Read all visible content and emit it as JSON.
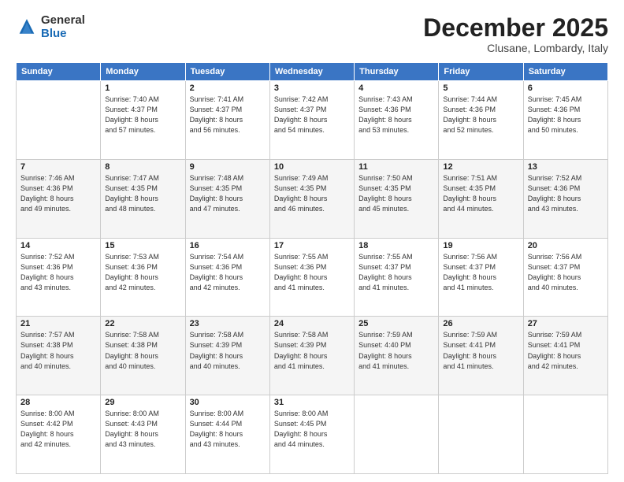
{
  "header": {
    "logo_general": "General",
    "logo_blue": "Blue",
    "month_title": "December 2025",
    "location": "Clusane, Lombardy, Italy"
  },
  "days_of_week": [
    "Sunday",
    "Monday",
    "Tuesday",
    "Wednesday",
    "Thursday",
    "Friday",
    "Saturday"
  ],
  "weeks": [
    [
      {
        "day": "",
        "info": ""
      },
      {
        "day": "1",
        "info": "Sunrise: 7:40 AM\nSunset: 4:37 PM\nDaylight: 8 hours\nand 57 minutes."
      },
      {
        "day": "2",
        "info": "Sunrise: 7:41 AM\nSunset: 4:37 PM\nDaylight: 8 hours\nand 56 minutes."
      },
      {
        "day": "3",
        "info": "Sunrise: 7:42 AM\nSunset: 4:37 PM\nDaylight: 8 hours\nand 54 minutes."
      },
      {
        "day": "4",
        "info": "Sunrise: 7:43 AM\nSunset: 4:36 PM\nDaylight: 8 hours\nand 53 minutes."
      },
      {
        "day": "5",
        "info": "Sunrise: 7:44 AM\nSunset: 4:36 PM\nDaylight: 8 hours\nand 52 minutes."
      },
      {
        "day": "6",
        "info": "Sunrise: 7:45 AM\nSunset: 4:36 PM\nDaylight: 8 hours\nand 50 minutes."
      }
    ],
    [
      {
        "day": "7",
        "info": "Sunrise: 7:46 AM\nSunset: 4:36 PM\nDaylight: 8 hours\nand 49 minutes."
      },
      {
        "day": "8",
        "info": "Sunrise: 7:47 AM\nSunset: 4:35 PM\nDaylight: 8 hours\nand 48 minutes."
      },
      {
        "day": "9",
        "info": "Sunrise: 7:48 AM\nSunset: 4:35 PM\nDaylight: 8 hours\nand 47 minutes."
      },
      {
        "day": "10",
        "info": "Sunrise: 7:49 AM\nSunset: 4:35 PM\nDaylight: 8 hours\nand 46 minutes."
      },
      {
        "day": "11",
        "info": "Sunrise: 7:50 AM\nSunset: 4:35 PM\nDaylight: 8 hours\nand 45 minutes."
      },
      {
        "day": "12",
        "info": "Sunrise: 7:51 AM\nSunset: 4:35 PM\nDaylight: 8 hours\nand 44 minutes."
      },
      {
        "day": "13",
        "info": "Sunrise: 7:52 AM\nSunset: 4:36 PM\nDaylight: 8 hours\nand 43 minutes."
      }
    ],
    [
      {
        "day": "14",
        "info": "Sunrise: 7:52 AM\nSunset: 4:36 PM\nDaylight: 8 hours\nand 43 minutes."
      },
      {
        "day": "15",
        "info": "Sunrise: 7:53 AM\nSunset: 4:36 PM\nDaylight: 8 hours\nand 42 minutes."
      },
      {
        "day": "16",
        "info": "Sunrise: 7:54 AM\nSunset: 4:36 PM\nDaylight: 8 hours\nand 42 minutes."
      },
      {
        "day": "17",
        "info": "Sunrise: 7:55 AM\nSunset: 4:36 PM\nDaylight: 8 hours\nand 41 minutes."
      },
      {
        "day": "18",
        "info": "Sunrise: 7:55 AM\nSunset: 4:37 PM\nDaylight: 8 hours\nand 41 minutes."
      },
      {
        "day": "19",
        "info": "Sunrise: 7:56 AM\nSunset: 4:37 PM\nDaylight: 8 hours\nand 41 minutes."
      },
      {
        "day": "20",
        "info": "Sunrise: 7:56 AM\nSunset: 4:37 PM\nDaylight: 8 hours\nand 40 minutes."
      }
    ],
    [
      {
        "day": "21",
        "info": "Sunrise: 7:57 AM\nSunset: 4:38 PM\nDaylight: 8 hours\nand 40 minutes."
      },
      {
        "day": "22",
        "info": "Sunrise: 7:58 AM\nSunset: 4:38 PM\nDaylight: 8 hours\nand 40 minutes."
      },
      {
        "day": "23",
        "info": "Sunrise: 7:58 AM\nSunset: 4:39 PM\nDaylight: 8 hours\nand 40 minutes."
      },
      {
        "day": "24",
        "info": "Sunrise: 7:58 AM\nSunset: 4:39 PM\nDaylight: 8 hours\nand 41 minutes."
      },
      {
        "day": "25",
        "info": "Sunrise: 7:59 AM\nSunset: 4:40 PM\nDaylight: 8 hours\nand 41 minutes."
      },
      {
        "day": "26",
        "info": "Sunrise: 7:59 AM\nSunset: 4:41 PM\nDaylight: 8 hours\nand 41 minutes."
      },
      {
        "day": "27",
        "info": "Sunrise: 7:59 AM\nSunset: 4:41 PM\nDaylight: 8 hours\nand 42 minutes."
      }
    ],
    [
      {
        "day": "28",
        "info": "Sunrise: 8:00 AM\nSunset: 4:42 PM\nDaylight: 8 hours\nand 42 minutes."
      },
      {
        "day": "29",
        "info": "Sunrise: 8:00 AM\nSunset: 4:43 PM\nDaylight: 8 hours\nand 43 minutes."
      },
      {
        "day": "30",
        "info": "Sunrise: 8:00 AM\nSunset: 4:44 PM\nDaylight: 8 hours\nand 43 minutes."
      },
      {
        "day": "31",
        "info": "Sunrise: 8:00 AM\nSunset: 4:45 PM\nDaylight: 8 hours\nand 44 minutes."
      },
      {
        "day": "",
        "info": ""
      },
      {
        "day": "",
        "info": ""
      },
      {
        "day": "",
        "info": ""
      }
    ]
  ]
}
